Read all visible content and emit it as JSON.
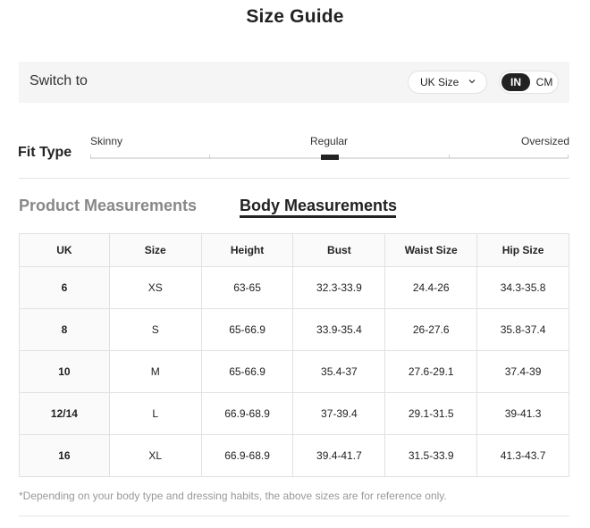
{
  "title": "Size Guide",
  "switch": {
    "label": "Switch to",
    "size_select_value": "UK Size",
    "unit_options": [
      "IN",
      "CM"
    ],
    "selected_unit": "IN"
  },
  "fit": {
    "label": "Fit Type",
    "options": [
      "Skinny",
      "Regular",
      "Oversized"
    ],
    "selected": "Regular"
  },
  "tabs": {
    "product": "Product Measurements",
    "body": "Body Measurements",
    "active": "Body Measurements"
  },
  "table": {
    "headers": [
      "UK",
      "Size",
      "Height",
      "Bust",
      "Waist Size",
      "Hip Size"
    ],
    "rows": [
      [
        "6",
        "XS",
        "63-65",
        "32.3-33.9",
        "24.4-26",
        "34.3-35.8"
      ],
      [
        "8",
        "S",
        "65-66.9",
        "33.9-35.4",
        "26-27.6",
        "35.8-37.4"
      ],
      [
        "10",
        "M",
        "65-66.9",
        "35.4-37",
        "27.6-29.1",
        "37.4-39"
      ],
      [
        "12/14",
        "L",
        "66.9-68.9",
        "37-39.4",
        "29.1-31.5",
        "39-41.3"
      ],
      [
        "16",
        "XL",
        "66.9-68.9",
        "39.4-41.7",
        "31.5-33.9",
        "41.3-43.7"
      ]
    ]
  },
  "footnote": "*Depending on your body type and dressing habits, the above sizes are for reference only.",
  "colors": {
    "accent": "#222222",
    "bar_background": "#f5f5f5",
    "inactive_tab": "#888888",
    "footnote": "#999999"
  }
}
